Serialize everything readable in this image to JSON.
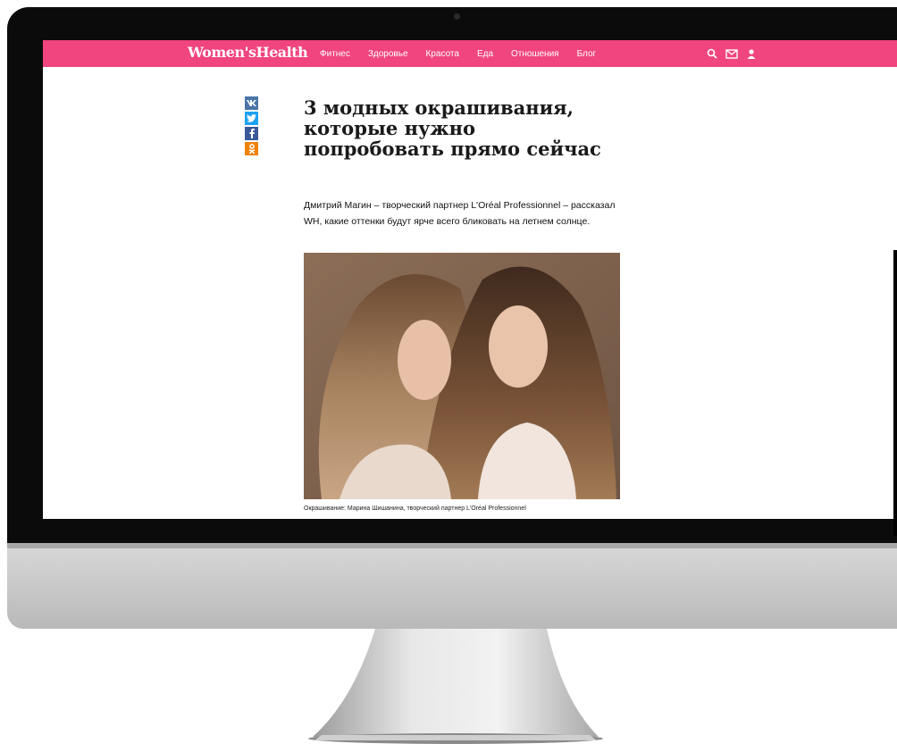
{
  "site": {
    "logo": "Women'sHealth"
  },
  "nav": {
    "items": [
      "Фитнес",
      "Здоровье",
      "Красота",
      "Еда",
      "Отношения",
      "Блог"
    ]
  },
  "header_icons": [
    "search-icon",
    "mail-icon",
    "user-icon"
  ],
  "share": [
    {
      "name": "vk-icon",
      "glyph": "vk"
    },
    {
      "name": "twitter-icon",
      "glyph": "🐦"
    },
    {
      "name": "facebook-icon",
      "glyph": "f"
    },
    {
      "name": "odnoklassniki-icon",
      "glyph": "ok"
    }
  ],
  "article": {
    "title": "3 модных окрашивания, которые нужно попробовать прямо сейчас",
    "lead": "Дмитрий Магин – творческий партнер L'Oréal Professionnel – рассказал WH, какие оттенки будут ярче всего бликовать на летнем солнце.",
    "image_caption": "Окрашивание: Марина Шишанина, творческий партнер L'Oréal Professionnel"
  },
  "colors": {
    "accent": "#f0457e",
    "vk": "#4a76a8",
    "twitter": "#1da1f2",
    "facebook": "#3b5998",
    "ok": "#ee8208"
  }
}
